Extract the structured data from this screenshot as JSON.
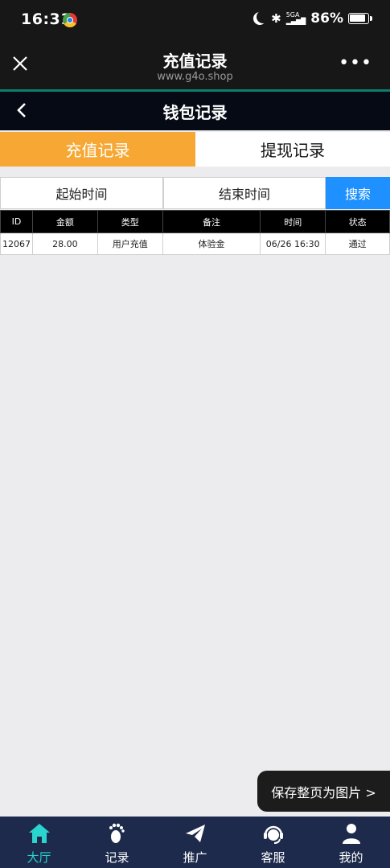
{
  "status_bar": {
    "time": "16:31",
    "network": "5GA",
    "battery": "86%"
  },
  "browser": {
    "title": "充值记录",
    "url": "www.g4o.shop"
  },
  "app_header": {
    "title": "钱包记录"
  },
  "tabs": [
    {
      "label": "充值记录",
      "active": true
    },
    {
      "label": "提现记录",
      "active": false
    }
  ],
  "filters": {
    "start_label": "起始时间",
    "end_label": "结束时间",
    "search_label": "搜索"
  },
  "table": {
    "headers": [
      "ID",
      "金额",
      "类型",
      "备注",
      "时间",
      "状态"
    ],
    "rows": [
      [
        "12067",
        "28.00",
        "用户充值",
        "体验金",
        "06/26 16:30",
        "通过"
      ]
    ]
  },
  "save_button": "保存整页为图片 >",
  "bottom_nav": [
    {
      "label": "大厅",
      "icon": "home-icon",
      "active": true
    },
    {
      "label": "记录",
      "icon": "footprint-icon",
      "active": false
    },
    {
      "label": "推广",
      "icon": "paper-plane-icon",
      "active": false
    },
    {
      "label": "客服",
      "icon": "headset-icon",
      "active": false
    },
    {
      "label": "我的",
      "icon": "user-icon",
      "active": false
    }
  ],
  "colors": {
    "accent": "#f7a733",
    "search": "#1e90ff",
    "nav_bg": "#1d2a4b",
    "nav_active": "#2ad4cf"
  }
}
